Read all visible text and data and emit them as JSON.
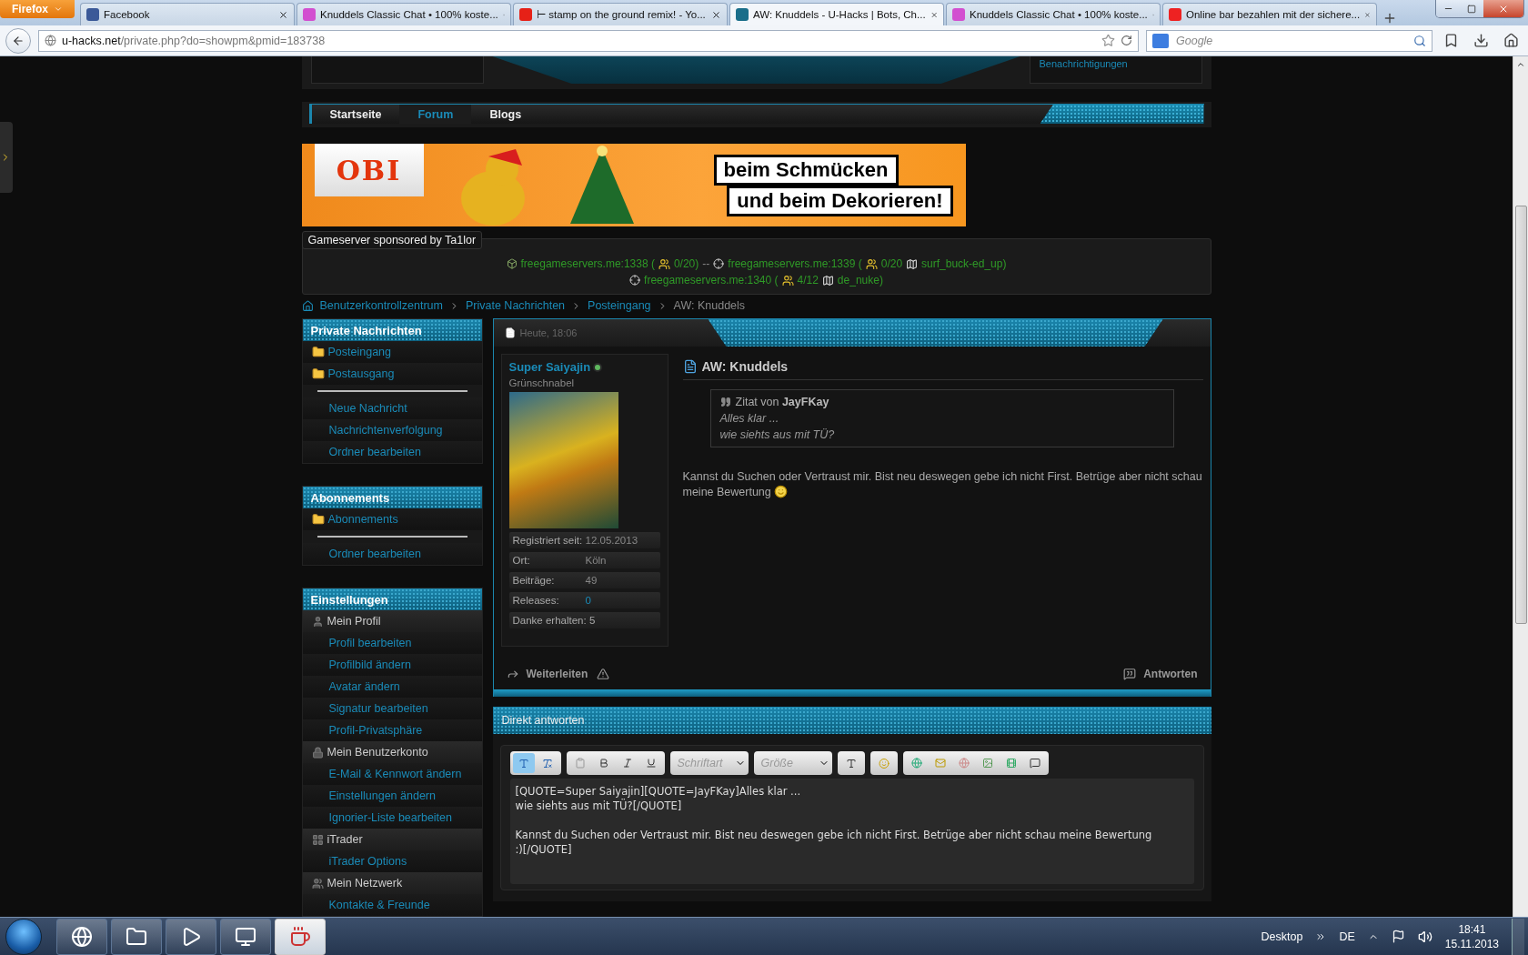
{
  "browser": {
    "menu_button": "Firefox",
    "tabs": [
      {
        "title": "Facebook",
        "selected": false
      },
      {
        "title": "Knuddels Classic Chat • 100% koste...",
        "selected": false
      },
      {
        "title": "⊢ stamp on the ground remix! - Yo...",
        "selected": false
      },
      {
        "title": "AW: Knuddels - U-Hacks | Bots, Ch...",
        "selected": true
      },
      {
        "title": "Knuddels Classic Chat • 100% koste...",
        "selected": false
      },
      {
        "title": "Online bar bezahlen mit der sichere...",
        "selected": false
      }
    ],
    "url_host": "u-hacks.net",
    "url_path": "/private.php?do=showpm&pmid=183738",
    "search_placeholder": "Google"
  },
  "header": {
    "notifications_link": "Benachrichtigungen"
  },
  "nav": [
    {
      "label": "Startseite",
      "selected": false
    },
    {
      "label": "Forum",
      "selected": true
    },
    {
      "label": "Blogs",
      "selected": false
    }
  ],
  "banner": {
    "brand": "OBI",
    "line_1": "beim Schmücken",
    "line_2": "und beim Dekorieren!"
  },
  "gameservers": {
    "title": "Gameserver sponsored by Ta1lor",
    "lines": [
      [
        {
          "kind": "block-game",
          "text": "freegameservers.me:1338 ("
        },
        {
          "kind": "players",
          "text": "0/20)"
        },
        {
          "kind": "separator",
          "text": "--"
        },
        {
          "kind": "shooter-game",
          "text": "freegameservers.me:1339 ("
        },
        {
          "kind": "players",
          "text": "0/20"
        },
        {
          "kind": "map",
          "text": "surf_buck-ed_up)"
        }
      ],
      [
        {
          "kind": "shooter-game",
          "text": "freegameservers.me:1340 ("
        },
        {
          "kind": "players",
          "text": "4/12"
        },
        {
          "kind": "map",
          "text": "de_nuke)"
        }
      ]
    ]
  },
  "breadcrumb": [
    {
      "label": "Benutzerkontrollzentrum",
      "current": false
    },
    {
      "label": "Private Nachrichten",
      "current": false
    },
    {
      "label": "Posteingang",
      "current": false
    },
    {
      "label": "AW: Knuddels",
      "current": true
    }
  ],
  "sidebar": [
    {
      "title": "Private Nachrichten",
      "folders": [
        "Posteingang",
        "Postausgang"
      ],
      "links": [
        {
          "kind": "link",
          "label": "Neue Nachricht"
        },
        {
          "kind": "link",
          "label": "Nachrichtenverfolgung"
        },
        {
          "kind": "link",
          "label": "Ordner bearbeiten"
        }
      ]
    },
    {
      "title": "Abonnements",
      "folders": [
        "Abonnements"
      ],
      "links": [
        {
          "kind": "link",
          "label": "Ordner bearbeiten"
        }
      ]
    },
    {
      "title": "Einstellungen",
      "links": [
        {
          "kind": "category",
          "label": "Mein Profil"
        },
        {
          "kind": "link",
          "label": "Profil bearbeiten"
        },
        {
          "kind": "link",
          "label": "Profilbild ändern"
        },
        {
          "kind": "link",
          "label": "Avatar ändern"
        },
        {
          "kind": "link",
          "label": "Signatur bearbeiten"
        },
        {
          "kind": "link",
          "label": "Profil-Privatsphäre"
        },
        {
          "kind": "category",
          "label": "Mein Benutzerkonto"
        },
        {
          "kind": "link",
          "label": "E-Mail & Kennwort ändern"
        },
        {
          "kind": "link",
          "label": "Einstellungen ändern"
        },
        {
          "kind": "link",
          "label": "Ignorier-Liste bearbeiten"
        },
        {
          "kind": "category",
          "label": "iTrader"
        },
        {
          "kind": "link",
          "label": "iTrader Options"
        },
        {
          "kind": "category",
          "label": "Mein Netzwerk"
        },
        {
          "kind": "link",
          "label": "Kontakte & Freunde"
        }
      ]
    }
  ],
  "post": {
    "date": "Heute, 18:06",
    "author": "Super Saiyajin",
    "online": true,
    "rank": "Grünschnabel",
    "stats": [
      {
        "kind": "pair",
        "label": "Registriert seit:",
        "value": "12.05.2013"
      },
      {
        "kind": "pair",
        "label": "Ort:",
        "value": "Köln"
      },
      {
        "kind": "pair",
        "label": "Beiträge:",
        "value": "49"
      },
      {
        "kind": "link",
        "label": "Releases:",
        "value": "0"
      },
      {
        "kind": "single",
        "label": "Danke erhalten: 5"
      }
    ],
    "title": "AW: Knuddels",
    "quote": {
      "label": "Zitat von",
      "author": "JayFKay",
      "lines": [
        "Alles klar ...",
        "wie siehts aus mit TÜ?"
      ]
    },
    "body": "Kannst du Suchen oder Vertraust mir. Bist neu deswegen gebe ich nicht First. Betrüge aber nicht schau meine Bewertung",
    "forward": "Weiterleiten",
    "reply": "Antworten"
  },
  "reply_box": {
    "title": "Direkt antworten",
    "modes": [
      {
        "selected": true
      },
      {
        "selected": false
      }
    ],
    "font_placeholder": "Schriftart",
    "size_placeholder": "Größe",
    "text": "[QUOTE=Super Saiyajin][QUOTE=JayFKay]Alles klar ...\nwie siehts aus mit TÜ?[/QUOTE]\n\nKannst du Suchen oder Vertraust mir. Bist neu deswegen gebe ich nicht First. Betrüge aber nicht schau meine Bewertung\n:)[/QUOTE]"
  },
  "taskbar": {
    "apps": [
      {
        "selected": false
      },
      {
        "selected": false
      },
      {
        "selected": false
      },
      {
        "selected": false
      },
      {
        "selected": true
      }
    ],
    "desktop": "Desktop",
    "language": "DE",
    "time": "18:41",
    "date": "15.11.2013"
  }
}
